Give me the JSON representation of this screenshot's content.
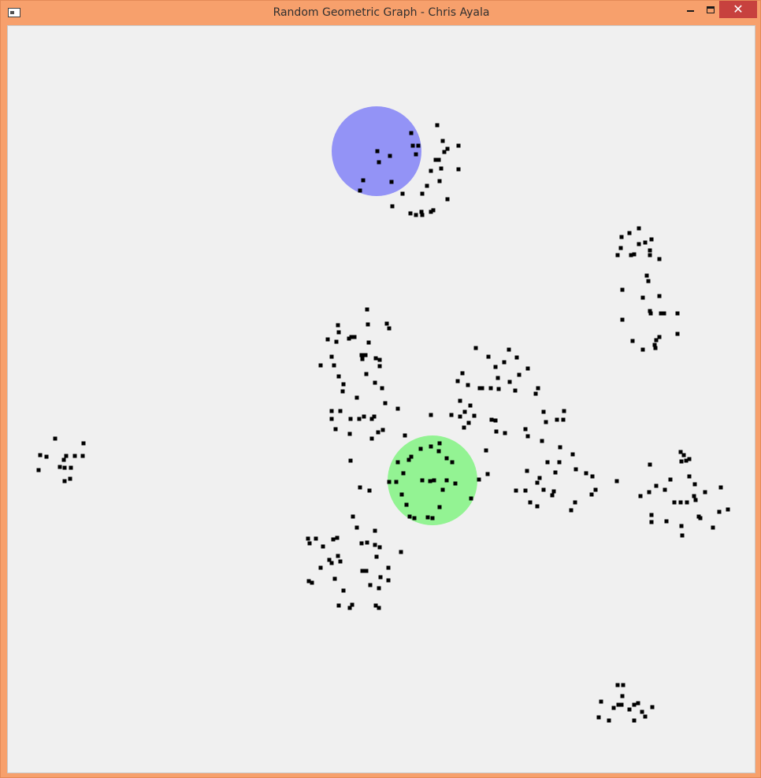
{
  "window": {
    "title": "Random Geometric Graph - Chris Ayala",
    "controls": {
      "minimize_icon": "minimize-icon",
      "maximize_icon": "maximize-icon",
      "close_glyph": "✕"
    }
  },
  "colors": {
    "background": "#f0f0f0",
    "node": "#000000",
    "blue_highlight": "#8c8cf5",
    "green_highlight": "#8cf58c",
    "frame": "#f7a06c",
    "close_button": "#c7413e"
  },
  "graph": {
    "highlights": [
      {
        "name": "blue-highlight-circle",
        "color": "#7c7cf8"
      },
      {
        "name": "green-highlight-circle",
        "color": "#7cf47c"
      }
    ]
  }
}
